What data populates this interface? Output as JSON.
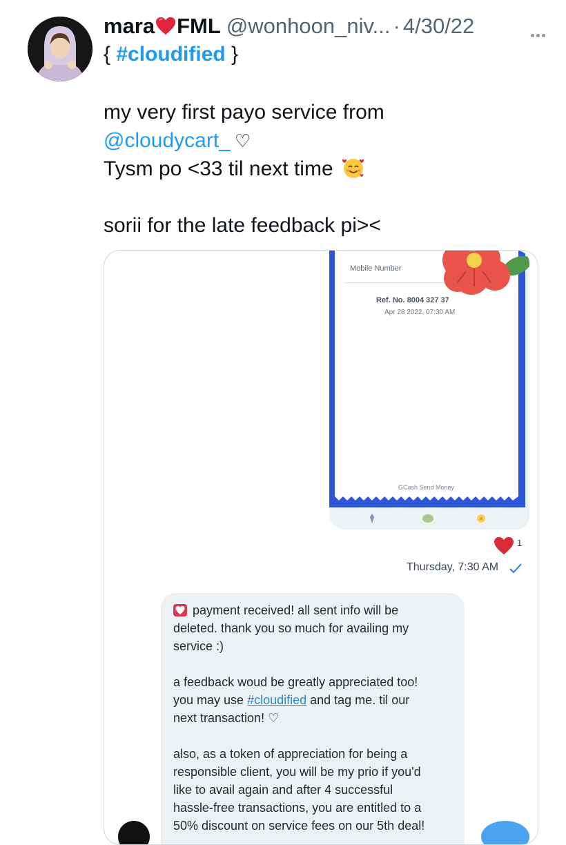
{
  "author": {
    "name_prefix": "mara",
    "name_suffix": "FML",
    "handle": "@wonhoon_niv...",
    "separator": "·",
    "date": "4/30/22",
    "tag_line_open": "{ ",
    "tag_line_tag": "#cloudified",
    "tag_line_close": " }"
  },
  "tweet": {
    "line1": "my very first payo service from",
    "mention": "@cloudycart_",
    "heart_glyph": "♡",
    "line3": "Tysm po <33 til next time",
    "line5": "sorii for the late feedback pi><"
  },
  "receipt": {
    "mobile_label": "Mobile Number",
    "ref_no": "Ref. No. 8004 327 37",
    "date_time": "Apr 28 2022, 07:30 AM",
    "footer": "GCash Send Money"
  },
  "dm": {
    "reaction_count": "1",
    "timestamp": "Thursday, 7:30 AM",
    "message": {
      "l1": "payment received! all sent info will be",
      "l2": "deleted. thank you so much for availing my",
      "l3": "service :)",
      "l5": "a feedback woud be greatly appreciated too!",
      "l6a": "you may use ",
      "l6tag": "#cloudified",
      "l6b": " and tag me. til our",
      "l7": "next transaction! ♡",
      "l9": "also, as a token of appreciation for being a",
      "l10": "responsible client, you will be my prio if you'd",
      "l11": "like to avail again and after 4 successful",
      "l12": "hassle-free transactions, you are entitled to a",
      "l13": "50% discount on service fees on our 5th deal!"
    }
  },
  "icons": {
    "avatar": "profile-photo",
    "name_emoji": "red-heart-icon",
    "more": "more-horizontal-icon",
    "text_emoji": "smiling-face-with-hearts-icon",
    "reaction": "red-heart-reaction-icon",
    "read": "check-icon"
  },
  "colors": {
    "link": "#1d9bf0",
    "muted": "#536471",
    "gcash_blue": "#2d55d8",
    "heart_red": "#d93852"
  }
}
